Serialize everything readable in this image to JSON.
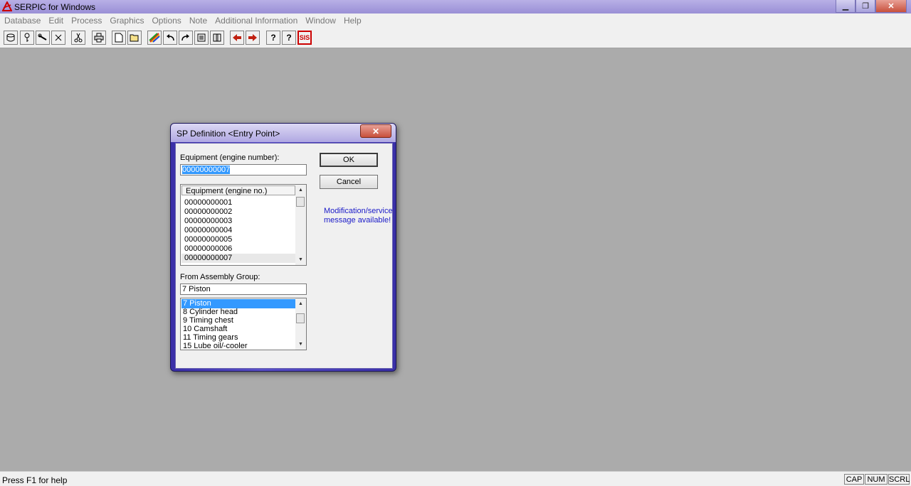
{
  "window": {
    "title": "SERPIC for Windows",
    "min_symbol": "▁",
    "max_symbol": "❐",
    "close_symbol": "✕"
  },
  "menu": [
    "Database",
    "Edit",
    "Process",
    "Graphics",
    "Options",
    "Note",
    "Additional Information",
    "Window",
    "Help"
  ],
  "toolbar": {
    "help_glyph": "?",
    "context_help_glyph": "?",
    "sis_label": "SIS"
  },
  "dialog": {
    "title": "SP Definition <Entry Point>",
    "close_symbol": "✕",
    "equipment_label": "Equipment (engine number):",
    "equipment_value": "00000000007",
    "list_header": "Equipment (engine no.)",
    "equipment_list": [
      "00000000001",
      "00000000002",
      "00000000003",
      "00000000004",
      "00000000005",
      "00000000006",
      "00000000007"
    ],
    "assembly_label": "From Assembly Group:",
    "assembly_value": "7 Piston",
    "assembly_list": [
      "7 Piston",
      "8 Cylinder head",
      "9 Timing chest",
      "10 Camshaft",
      "11 Timing gears",
      "15 Lube oil/-cooler"
    ],
    "ok_label": "OK",
    "cancel_label": "Cancel",
    "message_line1": "Modification/service",
    "message_line2": "message available!"
  },
  "status": {
    "help_text": "Press F1 for help",
    "cap": "CAP",
    "num": "NUM",
    "scrl": "SCRL"
  },
  "colors": {
    "workspace": "#ababab",
    "selection": "#3399ff",
    "message": "#1a1ac8"
  }
}
